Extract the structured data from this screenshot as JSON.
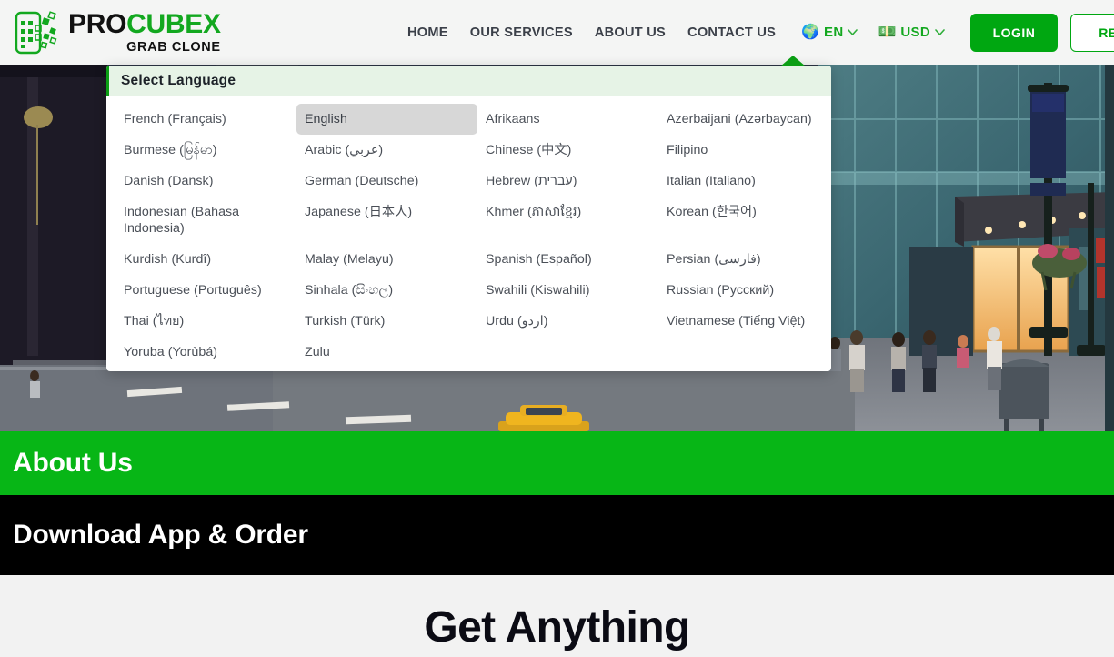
{
  "brand": {
    "title_part1": "PRO",
    "title_part2": "CUBE",
    "title_part3": "X",
    "subtitle": "GRAB CLONE",
    "logo_icon": "phone-cubes-icon"
  },
  "nav": {
    "links": [
      {
        "label": "HOME",
        "name": "nav-link-home"
      },
      {
        "label": "OUR SERVICES",
        "name": "nav-link-our-services"
      },
      {
        "label": "ABOUT US",
        "name": "nav-link-about-us"
      },
      {
        "label": "CONTACT US",
        "name": "nav-link-contact-us"
      }
    ],
    "language_selector": {
      "icon": "globe-icon",
      "emoji": "🌍",
      "code": "EN",
      "chevron": "chevron-down-icon"
    },
    "currency_selector": {
      "icon": "banknote-icon",
      "emoji": "💵",
      "code": "USD",
      "chevron": "chevron-down-icon"
    },
    "login_label": "LOGIN",
    "register_label": "REGISTER"
  },
  "language_dropdown": {
    "header": "Select Language",
    "selected": "English",
    "items": [
      "French (Français)",
      "English",
      "Afrikaans",
      "Azerbaijani (Azərbaycan)",
      "Burmese (မြန်မာ)",
      "Arabic (عربي)",
      "Chinese (中文)",
      "Filipino",
      "Danish (Dansk)",
      "German (Deutsche)",
      "Hebrew (עברית)",
      "Italian (Italiano)",
      "Indonesian (Bahasa Indonesia)",
      "Japanese (日本人)",
      "Khmer (ភាសាខ្មែរ)",
      "Korean (한국어)",
      "Kurdish (Kurdî)",
      "Malay (Melayu)",
      "Spanish (Español)",
      "Persian (فارسی)",
      "Portuguese (Português)",
      "Sinhala (සිංහල)",
      "Swahili (Kiswahili)",
      "Russian (Русский)",
      "Thai (ไทย)",
      "Turkish (Türk)",
      "Urdu (اردو)",
      "Vietnamese (Tiếng Việt)",
      "Yoruba (Yorùbá)",
      "Zulu"
    ]
  },
  "sections": {
    "about_title": "About Us",
    "download_title": "Download App & Order",
    "get_anything_title": "Get Anything"
  },
  "colors": {
    "brand_green": "#12a81f",
    "button_green": "#00a711",
    "section_green": "#07b616",
    "section_black": "#000000",
    "page_background": "#f2f2f2",
    "header_background": "#f4f5f4",
    "dropdown_header_background": "#e6f3e6",
    "selected_item_background": "#d7d7d7"
  },
  "hero": {
    "alt": "city street scene with pedestrians, taxi and storefronts"
  }
}
